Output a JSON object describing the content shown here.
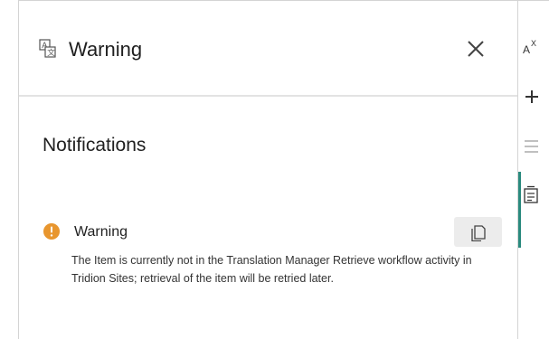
{
  "dialog": {
    "title": "Warning",
    "title_icon": "translate-icon",
    "close_icon": "close-icon"
  },
  "notifications": {
    "section_title": "Notifications",
    "items": [
      {
        "level": "warning",
        "icon": "warning-circle-icon",
        "title": "Warning",
        "message": "The Item is currently not in the Translation Manager Retrieve workflow activity in Tridion Sites; retrieval of the item will be retried later.",
        "copy_icon": "copy-icon"
      }
    ]
  },
  "rail": {
    "items": [
      {
        "icon": "translate-icon"
      },
      {
        "icon": "plus-icon"
      },
      {
        "icon": "list-icon"
      },
      {
        "icon": "checklist-icon",
        "active": true
      }
    ]
  },
  "colors": {
    "warning": "#e8962e",
    "accent": "#2a8a7e",
    "copy_button_bg": "#ececec"
  }
}
